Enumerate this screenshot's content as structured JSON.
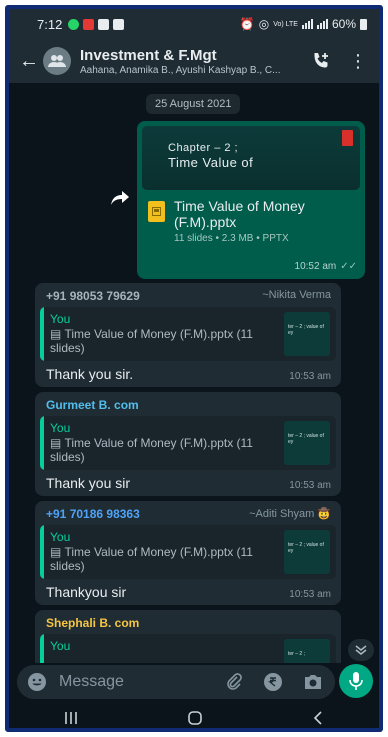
{
  "status_bar": {
    "time": "7:12",
    "network": "Vo) LTE",
    "battery": "60%"
  },
  "header": {
    "title": "Investment & F.Mgt",
    "subtitle": "Aahana, Anamika B., Ayushi Kashyap B., C..."
  },
  "chat": {
    "date": "25 August 2021",
    "outgoing": {
      "slide_line1": "Chapter – 2 ;",
      "slide_line2": "Time Value of",
      "file_name": "Time Value of Money (F.M).pptx",
      "file_meta": "11 slides • 2.3 MB • PPTX",
      "time": "10:52 am"
    },
    "messages": [
      {
        "sender": "+91 98053 79629",
        "sender_color": "#a6b3bb",
        "alias": "~Nikita Verma",
        "quote_author": "You",
        "quote_text": "Time Value of Money (F.M).pptx (11 slides)",
        "text": "Thank you sir.",
        "time": "10:53 am",
        "thumb": "ter – 2 ; value of ey"
      },
      {
        "sender": "Gurmeet B. com",
        "sender_color": "#53bdeb",
        "alias": "",
        "quote_author": "You",
        "quote_text": "Time Value of Money (F.M).pptx (11 slides)",
        "text": "Thank you sir",
        "time": "10:53 am",
        "thumb": "ter – 2 ; value of ey"
      },
      {
        "sender": "+91 70186 98363",
        "sender_color": "#4fa3f7",
        "alias": "~Aditi Shyam 🤠",
        "quote_author": "You",
        "quote_text": "Time Value of Money (F.M).pptx (11 slides)",
        "text": "Thankyou  sir",
        "time": "10:53 am",
        "thumb": "ter – 2 ; value of ey"
      },
      {
        "sender": "Shephali B. com",
        "sender_color": "#f5c542",
        "alias": "",
        "quote_author": "You",
        "quote_text": "",
        "text": "",
        "time": "",
        "thumb": "ter – 2 ;"
      }
    ]
  },
  "input": {
    "placeholder": "Message"
  },
  "colors": {
    "accent": "#00a884",
    "bubble_out": "#005c4b",
    "bubble_in": "#1f2c34",
    "background": "#0b141a"
  }
}
